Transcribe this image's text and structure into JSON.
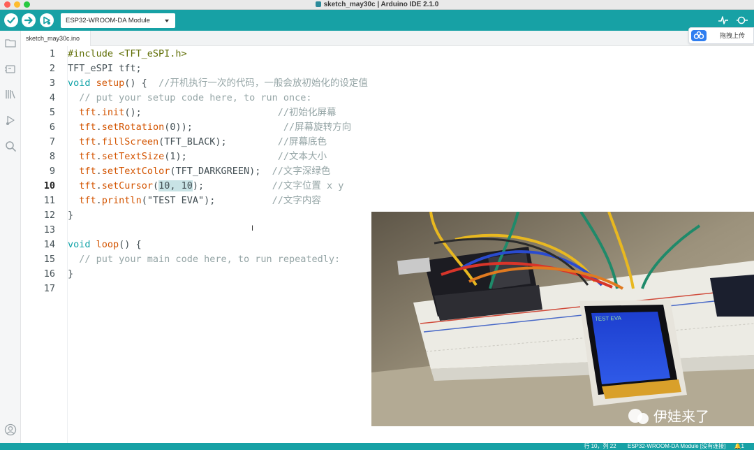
{
  "window": {
    "title": "sketch_may30c | Arduino IDE 2.1.0"
  },
  "toolbar": {
    "verify_icon": "check-icon",
    "upload_icon": "arrow-right-icon",
    "debugger_icon": "debug-icon",
    "board": "ESP32-WROOM-DA Module",
    "serial_plotter_icon": "pulse-icon",
    "serial_monitor_icon": "magnifier-icon"
  },
  "sidebar": {
    "items": [
      {
        "icon": "folder-icon"
      },
      {
        "icon": "board-manager-icon"
      },
      {
        "icon": "library-icon"
      },
      {
        "icon": "debug-icon"
      },
      {
        "icon": "search-icon"
      },
      {
        "icon": "account-icon"
      }
    ]
  },
  "tabs": [
    {
      "label": "sketch_may30c.ino"
    }
  ],
  "overlay": {
    "upload_label": "拖拽上传"
  },
  "editor": {
    "active_line": 10,
    "lines": [
      {
        "n": "1",
        "segs": [
          {
            "t": "#include <TFT_eSPI.h>",
            "c": "pp"
          }
        ]
      },
      {
        "n": "2",
        "segs": [
          {
            "t": "TFT_eSPI tft;",
            "c": ""
          }
        ]
      },
      {
        "n": "3",
        "segs": [
          {
            "t": "void",
            "c": "kw"
          },
          {
            "t": " ",
            "c": ""
          },
          {
            "t": "setup",
            "c": "fn"
          },
          {
            "t": "() {  ",
            "c": ""
          },
          {
            "t": "//开机执行一次的代码，一般会放初始化的设定值",
            "c": "cm"
          }
        ]
      },
      {
        "n": "4",
        "segs": [
          {
            "t": "  ",
            "c": ""
          },
          {
            "t": "// put your setup code here, to run once:",
            "c": "cm"
          }
        ]
      },
      {
        "n": "5",
        "segs": [
          {
            "t": "  ",
            "c": ""
          },
          {
            "t": "tft",
            "c": "fn"
          },
          {
            "t": ".",
            "c": ""
          },
          {
            "t": "init",
            "c": "fn"
          },
          {
            "t": "();                        ",
            "c": ""
          },
          {
            "t": "//初始化屏幕",
            "c": "cm"
          }
        ]
      },
      {
        "n": "6",
        "segs": [
          {
            "t": "  ",
            "c": ""
          },
          {
            "t": "tft",
            "c": "fn"
          },
          {
            "t": ".",
            "c": ""
          },
          {
            "t": "setRotation",
            "c": "fn"
          },
          {
            "t": "(0));                ",
            "c": ""
          },
          {
            "t": "//屏幕旋转方向",
            "c": "cm"
          }
        ]
      },
      {
        "n": "7",
        "segs": [
          {
            "t": "  ",
            "c": ""
          },
          {
            "t": "tft",
            "c": "fn"
          },
          {
            "t": ".",
            "c": ""
          },
          {
            "t": "fillScreen",
            "c": "fn"
          },
          {
            "t": "(TFT_BLACK);         ",
            "c": ""
          },
          {
            "t": "//屏幕底色",
            "c": "cm"
          }
        ]
      },
      {
        "n": "8",
        "segs": [
          {
            "t": "  ",
            "c": ""
          },
          {
            "t": "tft",
            "c": "fn"
          },
          {
            "t": ".",
            "c": ""
          },
          {
            "t": "setTextSize",
            "c": "fn"
          },
          {
            "t": "(1);                ",
            "c": ""
          },
          {
            "t": "//文本大小",
            "c": "cm"
          }
        ]
      },
      {
        "n": "9",
        "segs": [
          {
            "t": "  ",
            "c": ""
          },
          {
            "t": "tft",
            "c": "fn"
          },
          {
            "t": ".",
            "c": ""
          },
          {
            "t": "setTextColor",
            "c": "fn"
          },
          {
            "t": "(TFT_DARKGREEN);  ",
            "c": ""
          },
          {
            "t": "//文字深绿色",
            "c": "cm"
          }
        ]
      },
      {
        "n": "10",
        "segs": [
          {
            "t": "  ",
            "c": ""
          },
          {
            "t": "tft",
            "c": "fn"
          },
          {
            "t": ".",
            "c": ""
          },
          {
            "t": "setCursor",
            "c": "fn"
          },
          {
            "t": "(",
            "c": ""
          },
          {
            "t": "10, 10",
            "c": "hl"
          },
          {
            "t": ");            ",
            "c": ""
          },
          {
            "t": "//文字位置 x y",
            "c": "cm"
          }
        ]
      },
      {
        "n": "11",
        "segs": [
          {
            "t": "  ",
            "c": ""
          },
          {
            "t": "tft",
            "c": "fn"
          },
          {
            "t": ".",
            "c": ""
          },
          {
            "t": "println",
            "c": "fn"
          },
          {
            "t": "(\"TEST EVA\");          ",
            "c": ""
          },
          {
            "t": "//文字内容",
            "c": "cm"
          }
        ]
      },
      {
        "n": "12",
        "segs": [
          {
            "t": "}",
            "c": ""
          }
        ]
      },
      {
        "n": "13",
        "segs": []
      },
      {
        "n": "14",
        "segs": [
          {
            "t": "void",
            "c": "kw"
          },
          {
            "t": " ",
            "c": ""
          },
          {
            "t": "loop",
            "c": "fn"
          },
          {
            "t": "() {",
            "c": ""
          }
        ]
      },
      {
        "n": "15",
        "segs": [
          {
            "t": "  ",
            "c": ""
          },
          {
            "t": "// put your main code here, to run repeatedly:",
            "c": "cm"
          }
        ]
      },
      {
        "n": "16",
        "segs": [
          {
            "t": "}",
            "c": ""
          }
        ]
      },
      {
        "n": "17",
        "segs": []
      }
    ]
  },
  "photo": {
    "screen_text": "TEST EVA",
    "watermark": "伊娃来了"
  },
  "status": {
    "position": "行 10，列 22",
    "board_port": "ESP32-WROOM-DA Module [没有连接]",
    "notifications": "1"
  },
  "colors": {
    "accent": "#17a1a5",
    "keyword": "#0ca1a6",
    "function": "#d35400",
    "comment": "#95a5a6",
    "selection": "#c8e3e5"
  }
}
